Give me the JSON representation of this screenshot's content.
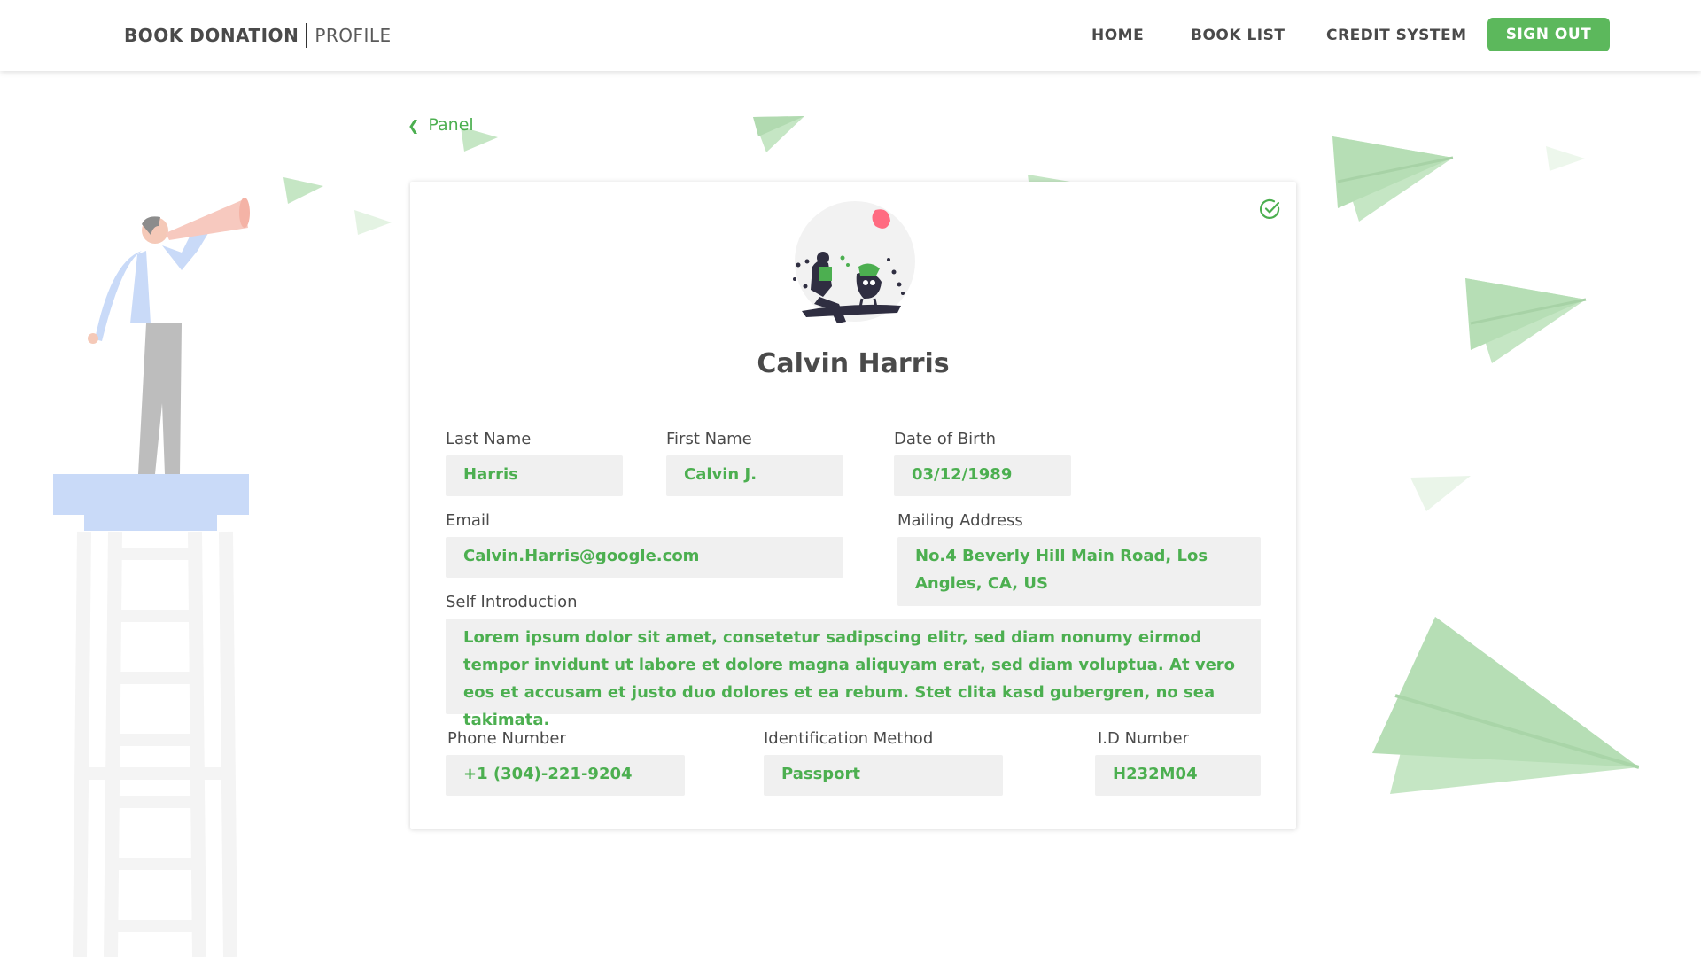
{
  "header": {
    "brand": "BOOK DONATION",
    "section": "PROFILE",
    "nav": [
      "HOME",
      "BOOK LIST",
      "CREDIT SYSTEM"
    ],
    "signout_label": "SIGN OUT"
  },
  "back_link": {
    "label": "Panel",
    "icon": "chevron-left-icon"
  },
  "profile": {
    "name": "Calvin Harris",
    "verified_icon": "check-circle-icon",
    "fields": {
      "last_name": {
        "label": "Last Name",
        "value": "Harris"
      },
      "first_name": {
        "label": "First Name",
        "value": "Calvin J."
      },
      "dob": {
        "label": "Date of Birth",
        "value": "03/12/1989"
      },
      "email": {
        "label": "Email",
        "value": "Calvin.Harris@google.com"
      },
      "mailing_address": {
        "label": "Mailing Address",
        "value": "No.4 Beverly Hill Main Road, Los Angles, CA, US"
      },
      "self_intro": {
        "label": "Self Introduction",
        "value": "Lorem ipsum dolor sit amet, consetetur sadipscing elitr, sed diam nonumy eirmod tempor invidunt ut labore et dolore magna aliquyam erat, sed diam voluptua. At vero eos et accusam et justo duo dolores et ea rebum. Stet clita kasd gubergren, no sea takimata."
      },
      "phone": {
        "label": "Phone Number",
        "value": "+1 (304)-221-9204"
      },
      "id_method": {
        "label": "Identification Method",
        "value": "Passport"
      },
      "id_number": {
        "label": "I.D Number",
        "value": "H232M04"
      }
    }
  },
  "colors": {
    "accent": "#4caf50",
    "button": "#5cb85c",
    "field_bg": "#f0f0f0",
    "plane": "#b6deb5"
  }
}
